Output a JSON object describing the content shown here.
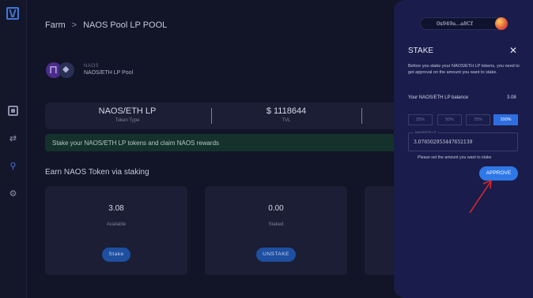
{
  "app": {
    "brand_color": "#3f79d6",
    "accent_color": "#2f78e8"
  },
  "sidebar": {
    "icons": [
      {
        "name": "dashboard-icon"
      },
      {
        "name": "transfer-icon"
      },
      {
        "name": "farm-icon"
      },
      {
        "name": "settings-icon"
      }
    ]
  },
  "breadcrumb": {
    "root": "Farm",
    "separator": ">",
    "current": "NAOS Pool LP POOL"
  },
  "pool": {
    "small_label": "NAOS",
    "name": "NAOS/ETH LP Pool"
  },
  "stats": [
    {
      "value": "NAOS/ETH LP",
      "label": "Token Type"
    },
    {
      "value": "$ 1118644",
      "label": "TVL"
    }
  ],
  "banner": {
    "text": "Stake your NAOS/ETH LP tokens and claim NAOS rewards"
  },
  "earn_title": "Earn NAOS Token via staking",
  "cards": [
    {
      "value": "3.08",
      "label": "Available",
      "button": "Stake"
    },
    {
      "value": "0.00",
      "label": "Staked",
      "button": "UNSTAKE"
    }
  ],
  "stake_panel": {
    "wallet_address": "0x949a...a8Cf",
    "title": "STAKE",
    "description": "Before you stake your NAOS/ETH LP tokens, you need to get approval on the amount you want to stake.",
    "balance_label": "Your NAOS/ETH LP balance",
    "balance_value": "3.08",
    "percent_options": [
      "25%",
      "50%",
      "75%",
      "100%"
    ],
    "selected_percent": "100%",
    "amount_label": "NAOS/ETH LP",
    "amount_value": "3.076502953447652139",
    "hint": "Please set the amount you want to stake",
    "approve_button": "APPROVE"
  }
}
